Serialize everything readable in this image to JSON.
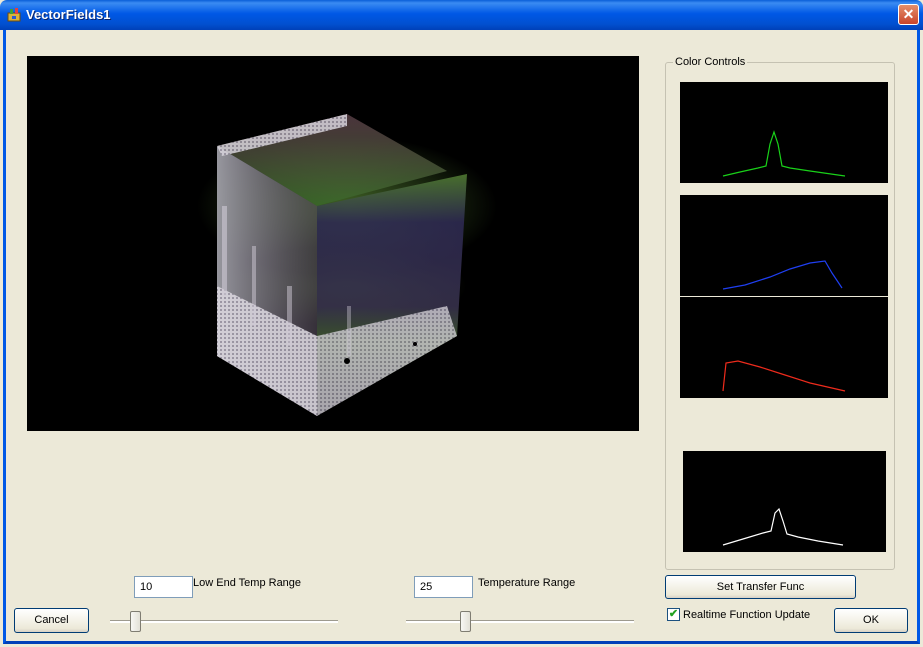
{
  "window": {
    "title": "VectorFields1",
    "close_symbol": "✕"
  },
  "color_controls": {
    "label": "Color Controls",
    "green_color": "#19d119",
    "blue_color": "#1f3ff2",
    "red_color": "#ee2b1c",
    "alpha_color": "#ffffff"
  },
  "controls": {
    "low_temp_value": "10",
    "low_temp_label": "Low End Temp Range",
    "temp_range_value": "25",
    "temp_range_label": "Temperature Range",
    "low_temp_slider_fraction": 0.11,
    "temp_range_slider_fraction": 0.26,
    "set_transfer_label": "Set Transfer Func",
    "realtime_label": "Realtime Function Update",
    "realtime_checked": true,
    "checkmark": "✔",
    "cancel_label": "Cancel",
    "ok_label": "OK"
  }
}
